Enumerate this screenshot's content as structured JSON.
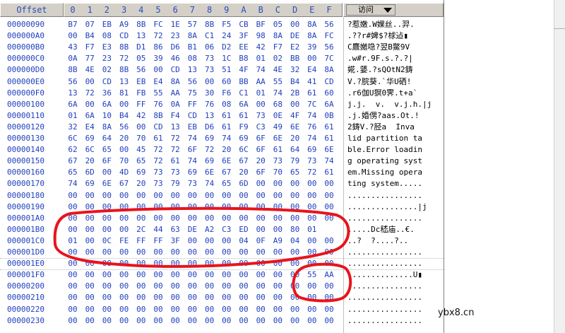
{
  "header": {
    "offset_label": "Offset",
    "columns": [
      "0",
      "1",
      "2",
      "3",
      "4",
      "5",
      "6",
      "7",
      "8",
      "9",
      "A",
      "B",
      "C",
      "D",
      "E",
      "F"
    ],
    "view_mode": "访问"
  },
  "rows": [
    {
      "offset": "00000090",
      "bytes": [
        "B7",
        "07",
        "EB",
        "A9",
        "8B",
        "FC",
        "1E",
        "57",
        "8B",
        "F5",
        "CB",
        "BF",
        "05",
        "00",
        "8A",
        "56"
      ],
      "text": "?惹嫩.W婐丝..羿."
    },
    {
      "offset": "000000A0",
      "bytes": [
        "00",
        "B4",
        "08",
        "CD",
        "13",
        "72",
        "23",
        "8A",
        "C1",
        "24",
        "3F",
        "98",
        "8A",
        "DE",
        "8A",
        "FC"
      ],
      "text": ".??r#婢$?梂迠▮"
    },
    {
      "offset": "000000B0",
      "bytes": [
        "43",
        "F7",
        "E3",
        "8B",
        "D1",
        "86",
        "D6",
        "B1",
        "06",
        "D2",
        "EE",
        "42",
        "F7",
        "E2",
        "39",
        "56"
      ],
      "text": "C麎嬔喼?翌B鱉9V"
    },
    {
      "offset": "000000C0",
      "bytes": [
        "0A",
        "77",
        "23",
        "72",
        "05",
        "39",
        "46",
        "08",
        "73",
        "1C",
        "B8",
        "01",
        "02",
        "BB",
        "00",
        "7C"
      ],
      "text": ".w#r.9F.s.?.?|"
    },
    {
      "offset": "000000D0",
      "bytes": [
        "8B",
        "4E",
        "02",
        "8B",
        "56",
        "00",
        "CD",
        "13",
        "73",
        "51",
        "4F",
        "74",
        "4E",
        "32",
        "E4",
        "8A"
      ],
      "text": "婲.婱.?sQOtN2鋳"
    },
    {
      "offset": "000000E0",
      "bytes": [
        "56",
        "00",
        "CD",
        "13",
        "EB",
        "E4",
        "8A",
        "56",
        "00",
        "60",
        "BB",
        "AA",
        "55",
        "B4",
        "41",
        "CD"
      ],
      "text": "V.?脘葵.`华U硒!"
    },
    {
      "offset": "000000F0",
      "bytes": [
        "13",
        "72",
        "36",
        "81",
        "FB",
        "55",
        "AA",
        "75",
        "30",
        "F6",
        "C1",
        "01",
        "74",
        "2B",
        "61",
        "60"
      ],
      "text": ".r6伽U猽0霁.t+a`"
    },
    {
      "offset": "00000100",
      "bytes": [
        "6A",
        "00",
        "6A",
        "00",
        "FF",
        "76",
        "0A",
        "FF",
        "76",
        "08",
        "6A",
        "00",
        "68",
        "00",
        "7C",
        "6A"
      ],
      "text": "j.j.  v.  v.j.h.|j"
    },
    {
      "offset": "00000110",
      "bytes": [
        "01",
        "6A",
        "10",
        "B4",
        "42",
        "8B",
        "F4",
        "CD",
        "13",
        "61",
        "61",
        "73",
        "0E",
        "4F",
        "74",
        "0B"
      ],
      "text": ".j.婚侽?aas.Ot.!"
    },
    {
      "offset": "00000120",
      "bytes": [
        "32",
        "E4",
        "8A",
        "56",
        "00",
        "CD",
        "13",
        "EB",
        "D6",
        "61",
        "F9",
        "C3",
        "49",
        "6E",
        "76",
        "61"
      ],
      "text": "2鋳V.?胫a  Inva"
    },
    {
      "offset": "00000130",
      "bytes": [
        "6C",
        "69",
        "64",
        "20",
        "70",
        "61",
        "72",
        "74",
        "69",
        "74",
        "69",
        "6F",
        "6E",
        "20",
        "74",
        "61"
      ],
      "text": "lid partition ta"
    },
    {
      "offset": "00000140",
      "bytes": [
        "62",
        "6C",
        "65",
        "00",
        "45",
        "72",
        "72",
        "6F",
        "72",
        "20",
        "6C",
        "6F",
        "61",
        "64",
        "69",
        "6E"
      ],
      "text": "ble.Error loadin"
    },
    {
      "offset": "00000150",
      "bytes": [
        "67",
        "20",
        "6F",
        "70",
        "65",
        "72",
        "61",
        "74",
        "69",
        "6E",
        "67",
        "20",
        "73",
        "79",
        "73",
        "74"
      ],
      "text": "g operating syst"
    },
    {
      "offset": "00000160",
      "bytes": [
        "65",
        "6D",
        "00",
        "4D",
        "69",
        "73",
        "73",
        "69",
        "6E",
        "67",
        "20",
        "6F",
        "70",
        "65",
        "72",
        "61"
      ],
      "text": "em.Missing opera"
    },
    {
      "offset": "00000170",
      "bytes": [
        "74",
        "69",
        "6E",
        "67",
        "20",
        "73",
        "79",
        "73",
        "74",
        "65",
        "6D",
        "00",
        "00",
        "00",
        "00",
        "00"
      ],
      "text": "ting system....."
    },
    {
      "offset": "00000180",
      "bytes": [
        "00",
        "00",
        "00",
        "00",
        "00",
        "00",
        "00",
        "00",
        "00",
        "00",
        "00",
        "00",
        "00",
        "00",
        "00",
        "00"
      ],
      "text": "................"
    },
    {
      "offset": "00000190",
      "bytes": [
        "00",
        "00",
        "00",
        "00",
        "00",
        "00",
        "00",
        "00",
        "00",
        "00",
        "00",
        "00",
        "00",
        "00",
        "00",
        "00"
      ],
      "text": "...............|j"
    },
    {
      "offset": "000001A0",
      "bytes": [
        "00",
        "00",
        "00",
        "00",
        "00",
        "00",
        "00",
        "00",
        "00",
        "00",
        "00",
        "00",
        "00",
        "00",
        "00",
        "00"
      ],
      "text": "................"
    },
    {
      "offset": "000001B0",
      "bytes": [
        "00",
        "00",
        "00",
        "00",
        "2C",
        "44",
        "63",
        "DE",
        "A2",
        "C3",
        "ED",
        "00",
        "00",
        "80",
        "01"
      ],
      "text": ".....Dc嵇庙..€."
    },
    {
      "offset": "000001C0",
      "bytes": [
        "01",
        "00",
        "0C",
        "FE",
        "FF",
        "FF",
        "3F",
        "00",
        "00",
        "00",
        "04",
        "0F",
        "A9",
        "04",
        "00",
        "00"
      ],
      "text": "..?  ?....?.."
    },
    {
      "offset": "000001D0",
      "bytes": [
        "00",
        "00",
        "00",
        "00",
        "00",
        "00",
        "00",
        "00",
        "00",
        "00",
        "00",
        "00",
        "00",
        "00",
        "00",
        "00"
      ],
      "text": "................"
    },
    {
      "offset": "000001E0",
      "bytes": [
        "00",
        "00",
        "00",
        "00",
        "00",
        "00",
        "00",
        "00",
        "00",
        "00",
        "00",
        "00",
        "00",
        "00",
        "00",
        "00"
      ],
      "text": "................"
    },
    {
      "offset": "000001F0",
      "bytes": [
        "00",
        "00",
        "00",
        "00",
        "00",
        "00",
        "00",
        "00",
        "00",
        "00",
        "00",
        "00",
        "00",
        "00",
        "55",
        "AA"
      ],
      "text": "..............U▮"
    },
    {
      "offset": "00000200",
      "bytes": [
        "00",
        "00",
        "00",
        "00",
        "00",
        "00",
        "00",
        "00",
        "00",
        "00",
        "00",
        "00",
        "00",
        "00",
        "00",
        "00"
      ],
      "text": "................"
    },
    {
      "offset": "00000210",
      "bytes": [
        "00",
        "00",
        "00",
        "00",
        "00",
        "00",
        "00",
        "00",
        "00",
        "00",
        "00",
        "00",
        "00",
        "00",
        "00",
        "00"
      ],
      "text": "................"
    },
    {
      "offset": "00000220",
      "bytes": [
        "00",
        "00",
        "00",
        "00",
        "00",
        "00",
        "00",
        "00",
        "00",
        "00",
        "00",
        "00",
        "00",
        "00",
        "00",
        "00"
      ],
      "text": "................"
    },
    {
      "offset": "00000230",
      "bytes": [
        "00",
        "00",
        "00",
        "00",
        "00",
        "00",
        "00",
        "00",
        "00",
        "00",
        "00",
        "00",
        "00",
        "00",
        "00",
        "00"
      ],
      "text": "................"
    }
  ],
  "watermark": "ybx8.cn",
  "colors": {
    "hex_text": "#1f3fbf",
    "header_bg": "#d4d0c8",
    "annotation": "#e8141c"
  }
}
